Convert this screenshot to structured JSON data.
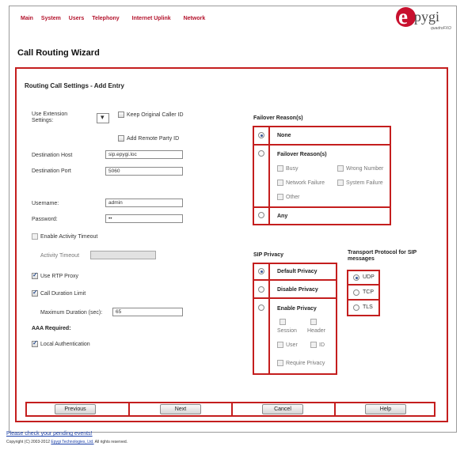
{
  "nav": {
    "items": [
      "Main",
      "System",
      "Users",
      "Telephony",
      "Internet Uplink",
      "Network"
    ]
  },
  "logo": {
    "brand": "epygi",
    "sub": "quadroFXO"
  },
  "page_title": "Call Routing Wizard",
  "panel_title": "Routing Call Settings - Add Entry",
  "left": {
    "use_extension_label": "Use Extension Settings:",
    "keep_caller_id": "Keep Original Caller ID",
    "add_remote_party_id": "Add Remote Party ID",
    "dest_host_label": "Destination Host",
    "dest_host_value": "sip.epygi.loc",
    "dest_port_label": "Destination Port",
    "dest_port_value": "5060",
    "username_label": "Username:",
    "username_value": "admin",
    "password_label": "Password:",
    "password_value": "••",
    "enable_activity_timeout": "Enable Activity Timeout",
    "activity_timeout_label": "Activity Timeout",
    "use_rtp_proxy": "Use RTP Proxy",
    "call_duration_limit": "Call Duration Limit",
    "max_duration_label": "Maximum Duration (sec):",
    "max_duration_value": "65",
    "aaa_required": "AAA Required:",
    "local_auth": "Local Authentication"
  },
  "failover": {
    "title": "Failover Reason(s)",
    "none": "None",
    "reasons_title": "Failover Reason(s)",
    "busy": "Busy",
    "wrong_number": "Wrong Number",
    "network_failure": "Network Failure",
    "system_failure": "System Failure",
    "other": "Other",
    "any": "Any"
  },
  "sip_privacy": {
    "title": "SIP Privacy",
    "default": "Default Privacy",
    "disable": "Disable Privacy",
    "enable": "Enable Privacy",
    "session": "Session",
    "header": "Header",
    "user": "User",
    "id": "ID",
    "require": "Require Privacy"
  },
  "transport": {
    "title": "Transport Protocol for SIP messages",
    "udp": "UDP",
    "tcp": "TCP",
    "tls": "TLS"
  },
  "buttons": {
    "previous": "Previous",
    "next": "Next",
    "cancel": "Cancel",
    "help": "Help"
  },
  "footer": {
    "pending_link": "Please check your pending events!",
    "copyright_pre": "Copyright (C) 2003-2012",
    "company": "Epygi Technologies, Ltd.",
    "copyright_post": "All rights reserved."
  },
  "colors": {
    "accent": "#c41e1e",
    "nav": "#b3122b",
    "link": "#1a3fa8"
  }
}
